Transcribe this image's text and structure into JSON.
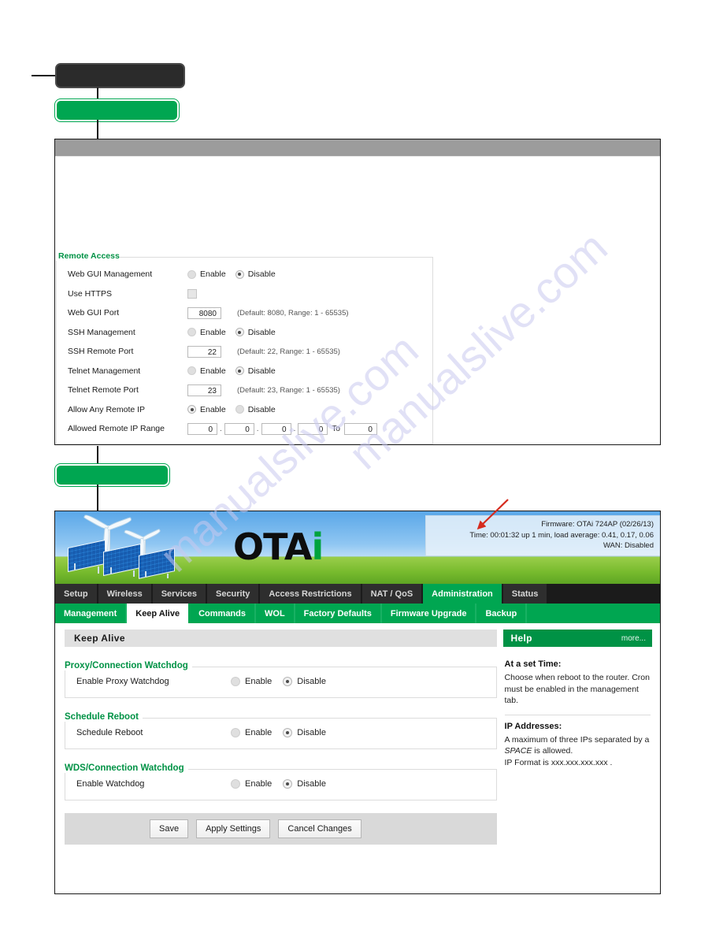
{
  "callouts": {
    "dark_label": "",
    "green_label_top": "",
    "green_label_bottom": ""
  },
  "upper_panel": {
    "header_label": "",
    "remote_access": {
      "legend": "Remote Access",
      "rows": [
        {
          "label": "Web GUI Management",
          "type": "radio",
          "options": [
            "Enable",
            "Disable"
          ],
          "selected": "Disable",
          "hint": ""
        },
        {
          "label": "Use HTTPS",
          "type": "checkbox",
          "checked": false,
          "hint": ""
        },
        {
          "label": "Web GUI Port",
          "type": "text",
          "value": "8080",
          "hint": "(Default: 8080, Range: 1 - 65535)"
        },
        {
          "label": "SSH Management",
          "type": "radio",
          "options": [
            "Enable",
            "Disable"
          ],
          "selected": "Disable",
          "hint": ""
        },
        {
          "label": "SSH Remote Port",
          "type": "text",
          "value": "22",
          "hint": "(Default: 22, Range: 1 - 65535)"
        },
        {
          "label": "Telnet Management",
          "type": "radio",
          "options": [
            "Enable",
            "Disable"
          ],
          "selected": "Disable",
          "hint": ""
        },
        {
          "label": "Telnet Remote Port",
          "type": "text",
          "value": "23",
          "hint": "(Default: 23, Range: 1 - 65535)"
        },
        {
          "label": "Allow Any Remote IP",
          "type": "radio",
          "options": [
            "Enable",
            "Disable"
          ],
          "selected": "Enable",
          "hint": ""
        },
        {
          "label": "Allowed Remote IP Range",
          "type": "iprange",
          "octets": [
            "0",
            "0",
            "0",
            "0"
          ],
          "to_label": "To",
          "to_value": "0",
          "hint": ""
        }
      ]
    }
  },
  "router": {
    "banner": {
      "logo_ota": "OTA",
      "logo_i": "i",
      "info": {
        "firmware_line": "Firmware: OTAi 724AP (02/26/13)",
        "time_line": "Time: 00:01:32 up 1 min, load average: 0.41, 0.17, 0.06",
        "wan_line": "WAN: Disabled"
      }
    },
    "main_tabs": [
      {
        "label": "Setup",
        "active": false
      },
      {
        "label": "Wireless",
        "active": false
      },
      {
        "label": "Services",
        "active": false
      },
      {
        "label": "Security",
        "active": false
      },
      {
        "label": "Access Restrictions",
        "active": false
      },
      {
        "label": "NAT / QoS",
        "active": false
      },
      {
        "label": "Administration",
        "active": true
      },
      {
        "label": "Status",
        "active": false
      }
    ],
    "sub_tabs": [
      {
        "label": "Management",
        "active": false
      },
      {
        "label": "Keep Alive",
        "active": true
      },
      {
        "label": "Commands",
        "active": false
      },
      {
        "label": "WOL",
        "active": false
      },
      {
        "label": "Factory Defaults",
        "active": false
      },
      {
        "label": "Firmware Upgrade",
        "active": false
      },
      {
        "label": "Backup",
        "active": false
      }
    ],
    "page_title": "Keep Alive",
    "sections": [
      {
        "title": "Proxy/Connection Watchdog",
        "row_label": "Enable Proxy Watchdog",
        "options": [
          "Enable",
          "Disable"
        ],
        "selected": "Disable"
      },
      {
        "title": "Schedule Reboot",
        "row_label": "Schedule Reboot",
        "options": [
          "Enable",
          "Disable"
        ],
        "selected": "Disable"
      },
      {
        "title": "WDS/Connection Watchdog",
        "row_label": "Enable Watchdog",
        "options": [
          "Enable",
          "Disable"
        ],
        "selected": "Disable"
      }
    ],
    "buttons": [
      {
        "label": "Save"
      },
      {
        "label": "Apply Settings"
      },
      {
        "label": "Cancel Changes"
      }
    ],
    "help": {
      "title": "Help",
      "more": "more...",
      "blocks": [
        {
          "heading": "At a set Time:",
          "text": "Choose when reboot to the router. Cron must be enabled in the management tab."
        },
        {
          "heading": "IP Addresses:",
          "text_a": "A maximum of three IPs separated by a ",
          "text_em": "SPACE",
          "text_b": " is allowed.",
          "text_c": "IP Format is xxx.xxx.xxx.xxx ."
        }
      ]
    }
  },
  "watermark": {
    "line1": "manualslive.com",
    "line2": "manualslive.com"
  },
  "colors": {
    "brand_green": "#00a651",
    "header_green": "#009245",
    "tab_dark": "#2e2e2e",
    "arrow_red": "#d52b1e"
  }
}
